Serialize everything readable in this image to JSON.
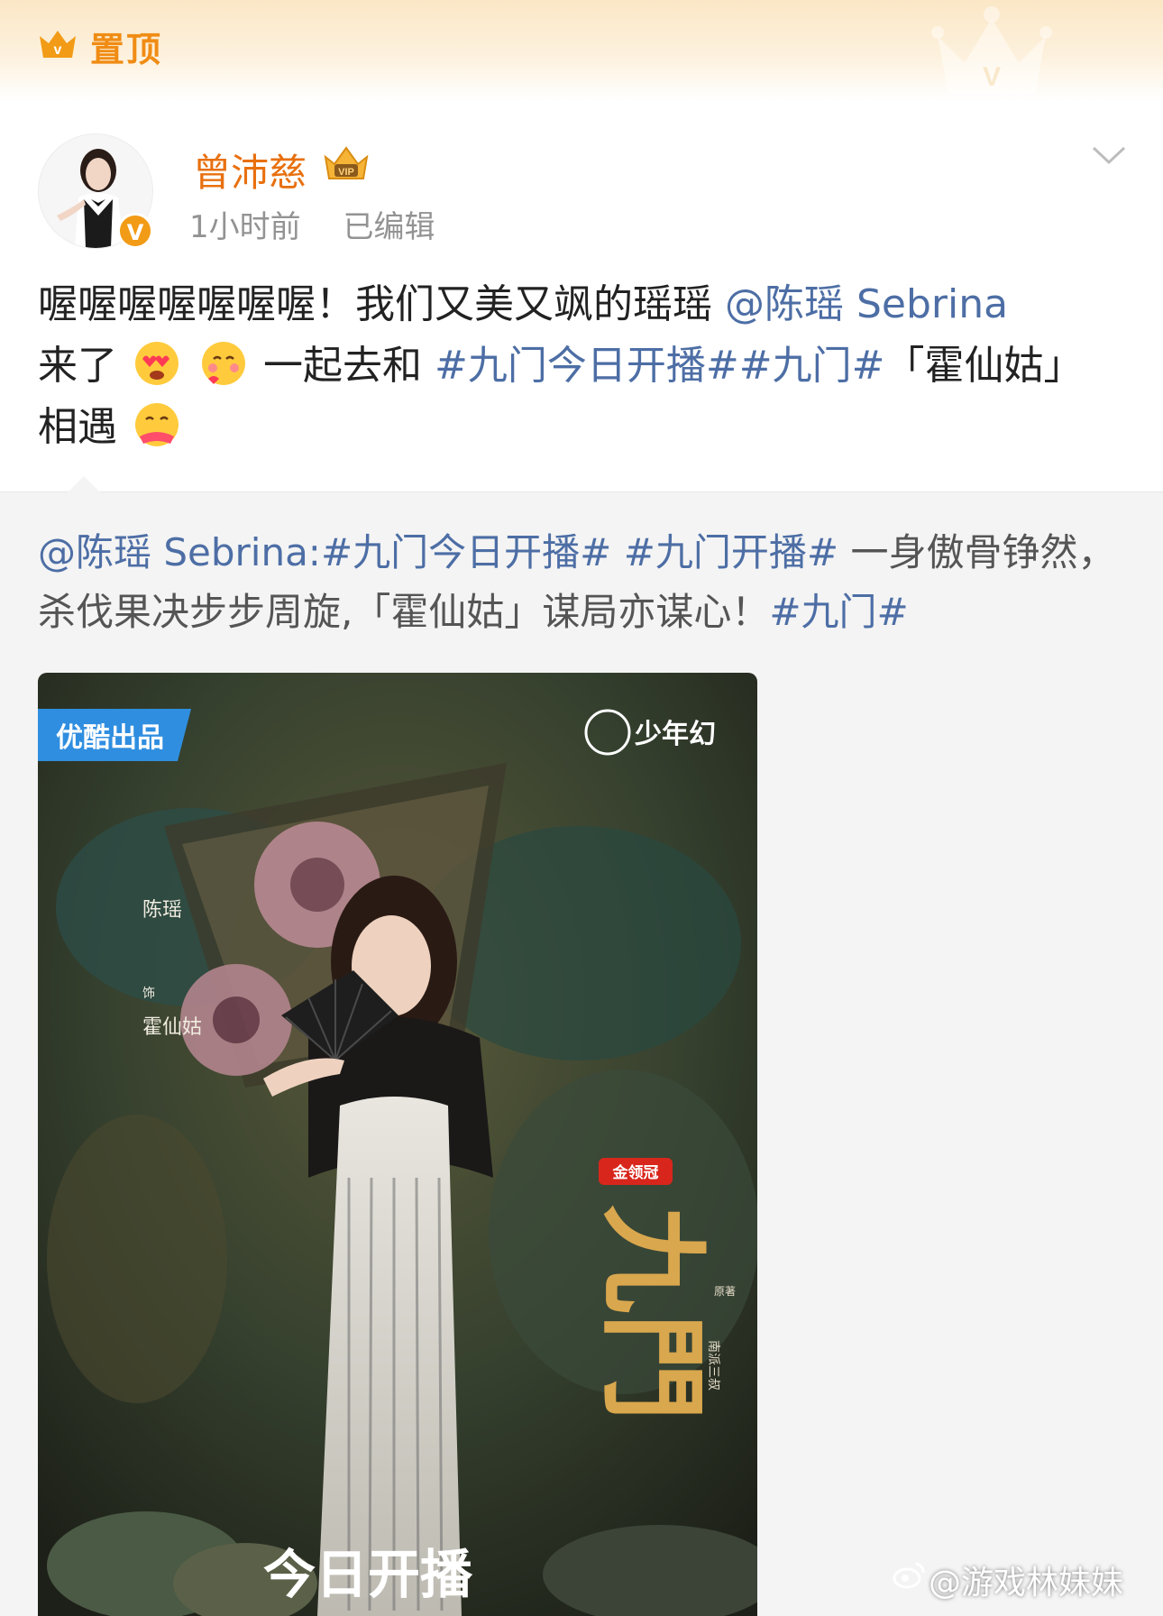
{
  "pinned": {
    "label": "置顶"
  },
  "author": {
    "name": "曾沛慈",
    "time": "1小时前",
    "edited": "已编辑",
    "verified_mark": "V"
  },
  "post": {
    "text_1": "喔喔喔喔喔喔喔！我们又美又飒的瑶瑶 ",
    "mention": "@陈瑶 Sebrina",
    "text_2": "来了",
    "text_3": " 一起去和 ",
    "hashtag_1": "#九门今日开播#",
    "hashtag_2": "#九门#",
    "text_4": "「霍仙姑」",
    "text_5": "相遇"
  },
  "repost": {
    "mention": "@陈瑶 Sebrina:",
    "hashtag_1": "#九门今日开播#",
    "hashtag_2": " #九门开播#",
    "body": " 一身傲骨铮然，杀伐果决步步周旋,「霍仙姑」谋局亦谋心！",
    "hashtag_3": "#九门#"
  },
  "poster": {
    "brand_tag": "优酷出品",
    "studio": "少年幻",
    "cast_name": "陈瑶",
    "cast_as": "饰",
    "role": "霍仙姑",
    "sponsor": "金领冠",
    "title": "九門",
    "original": "原著",
    "author": "南派三叔",
    "premiere": "今日开播"
  },
  "watermark": {
    "text": "@游戏林妹妹"
  },
  "icons": [
    "vip-crown-icon",
    "verified-icon",
    "chevron-down-icon",
    "heart-eyes-emoji-icon",
    "blush-emoji-icon",
    "hug-emoji-icon",
    "weibo-logo-icon",
    "crown-decoration-icon"
  ]
}
